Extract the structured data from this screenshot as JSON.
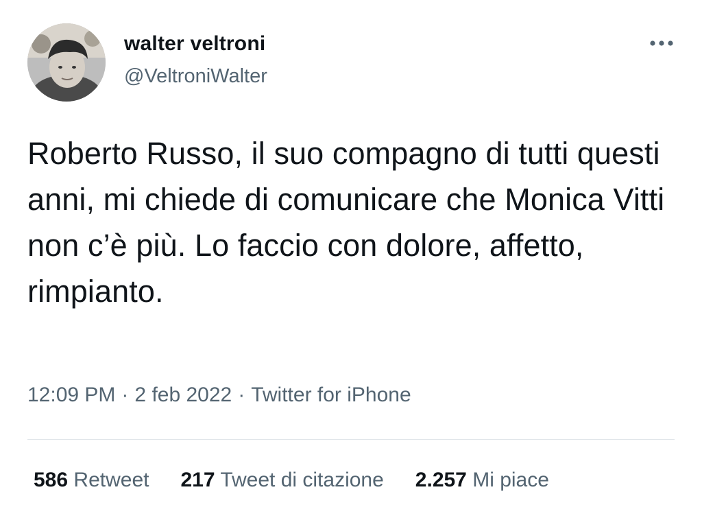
{
  "author": {
    "display_name": "walter veltroni",
    "handle": "@VeltroniWalter"
  },
  "icons": {
    "more": "more-horizontal-icon",
    "avatar": "profile-photo"
  },
  "tweet": {
    "text": "Roberto Russo, il suo compagno di tutti questi anni, mi chiede di comunicare che Monica Vitti non c’è più. Lo faccio con dolore, affetto, rimpianto.",
    "time": "12:09 PM",
    "date": "2 feb 2022",
    "source": "Twitter for iPhone",
    "separator": "·"
  },
  "stats": {
    "retweets_count": "586",
    "retweets_label": "Retweet",
    "quotes_count": "217",
    "quotes_label": "Tweet di citazione",
    "likes_count": "2.257",
    "likes_label": "Mi piace"
  },
  "colors": {
    "primary_text": "#0f1419",
    "secondary_text": "#536471",
    "divider": "#e1e6ea"
  }
}
